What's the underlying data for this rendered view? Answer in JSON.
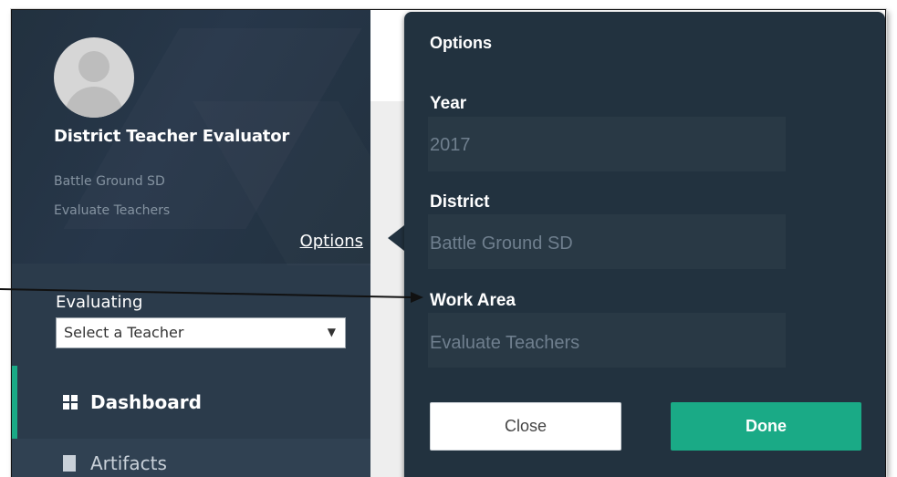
{
  "sidebar": {
    "user_name": "District Teacher Evaluator",
    "organization": "Battle Ground SD",
    "work_area": "Evaluate Teachers",
    "options_link": "Options",
    "evaluating_label": "Evaluating",
    "teacher_select": {
      "value": "Select a Teacher"
    },
    "nav": [
      {
        "label": "Dashboard",
        "icon": "grid-icon",
        "active": true
      },
      {
        "label": "Artifacts",
        "icon": "document-icon",
        "active": false
      }
    ]
  },
  "popover": {
    "title": "Options",
    "fields": [
      {
        "label": "Year",
        "value": "2017"
      },
      {
        "label": "District",
        "value": "Battle Ground SD"
      },
      {
        "label": "Work Area",
        "value": "Evaluate Teachers"
      }
    ],
    "close_label": "Close",
    "done_label": "Done"
  },
  "colors": {
    "sidebar_bg": "#2b3b4b",
    "popover_bg": "#22323f",
    "accent": "#1aaa86"
  }
}
